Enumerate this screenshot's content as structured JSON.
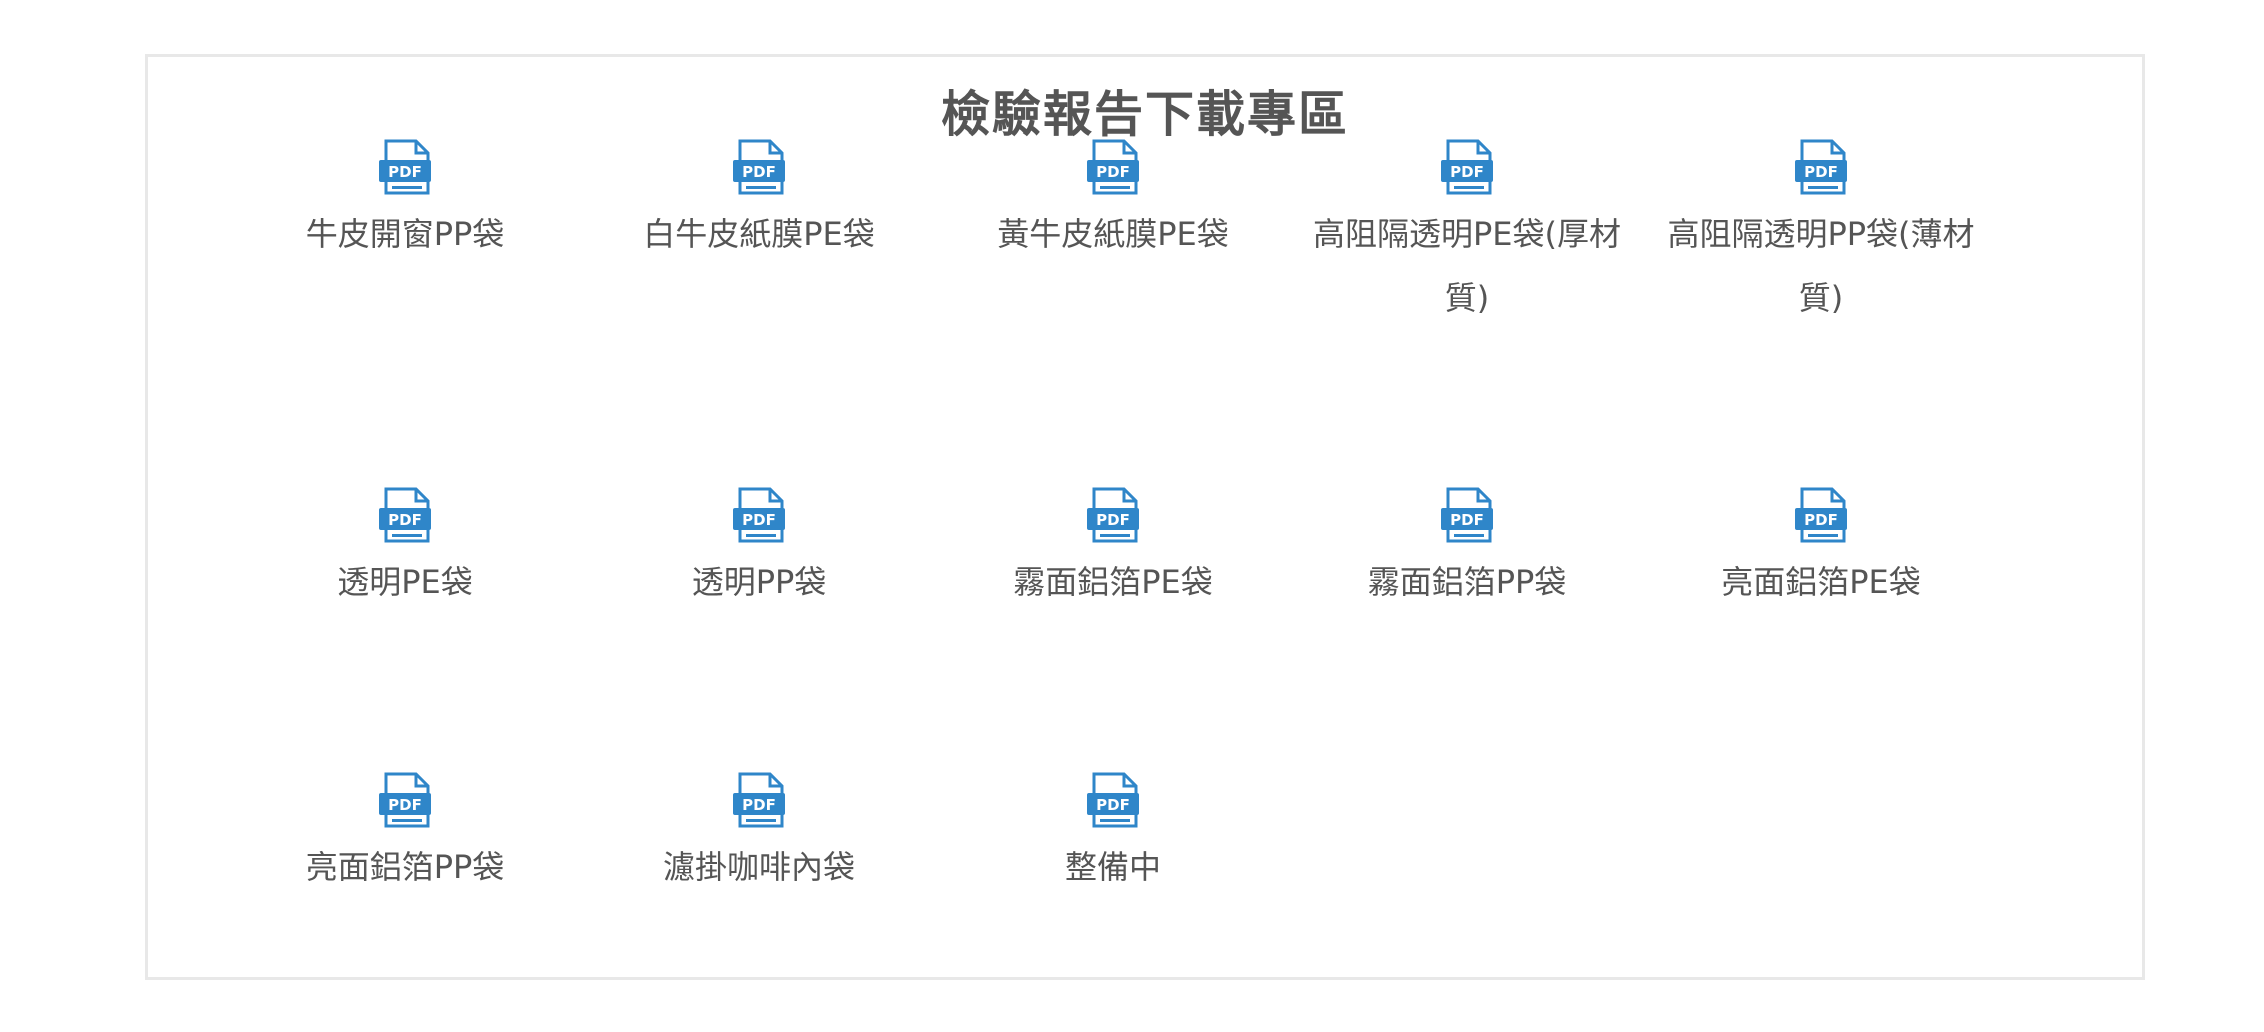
{
  "section": {
    "title": "檢驗報告下載專區"
  },
  "items": [
    {
      "label": "牛皮開窗PP袋",
      "icon": "pdf-icon"
    },
    {
      "label": "白牛皮紙膜PE袋",
      "icon": "pdf-icon"
    },
    {
      "label": "黃牛皮紙膜PE袋",
      "icon": "pdf-icon"
    },
    {
      "label": "高阻隔透明PE袋(厚材質)",
      "icon": "pdf-icon"
    },
    {
      "label": "高阻隔透明PP袋(薄材質)",
      "icon": "pdf-icon"
    },
    {
      "label": "透明PE袋",
      "icon": "pdf-icon"
    },
    {
      "label": "透明PP袋",
      "icon": "pdf-icon"
    },
    {
      "label": "霧面鋁箔PE袋",
      "icon": "pdf-icon"
    },
    {
      "label": "霧面鋁箔PP袋",
      "icon": "pdf-icon"
    },
    {
      "label": "亮面鋁箔PE袋",
      "icon": "pdf-icon"
    },
    {
      "label": "亮面鋁箔PP袋",
      "icon": "pdf-icon"
    },
    {
      "label": "濾掛咖啡內袋",
      "icon": "pdf-icon"
    },
    {
      "label": "整備中",
      "icon": "pdf-icon"
    }
  ],
  "colors": {
    "icon_blue": "#2f86c9",
    "text": "#555555",
    "border": "#e8e8e8"
  }
}
